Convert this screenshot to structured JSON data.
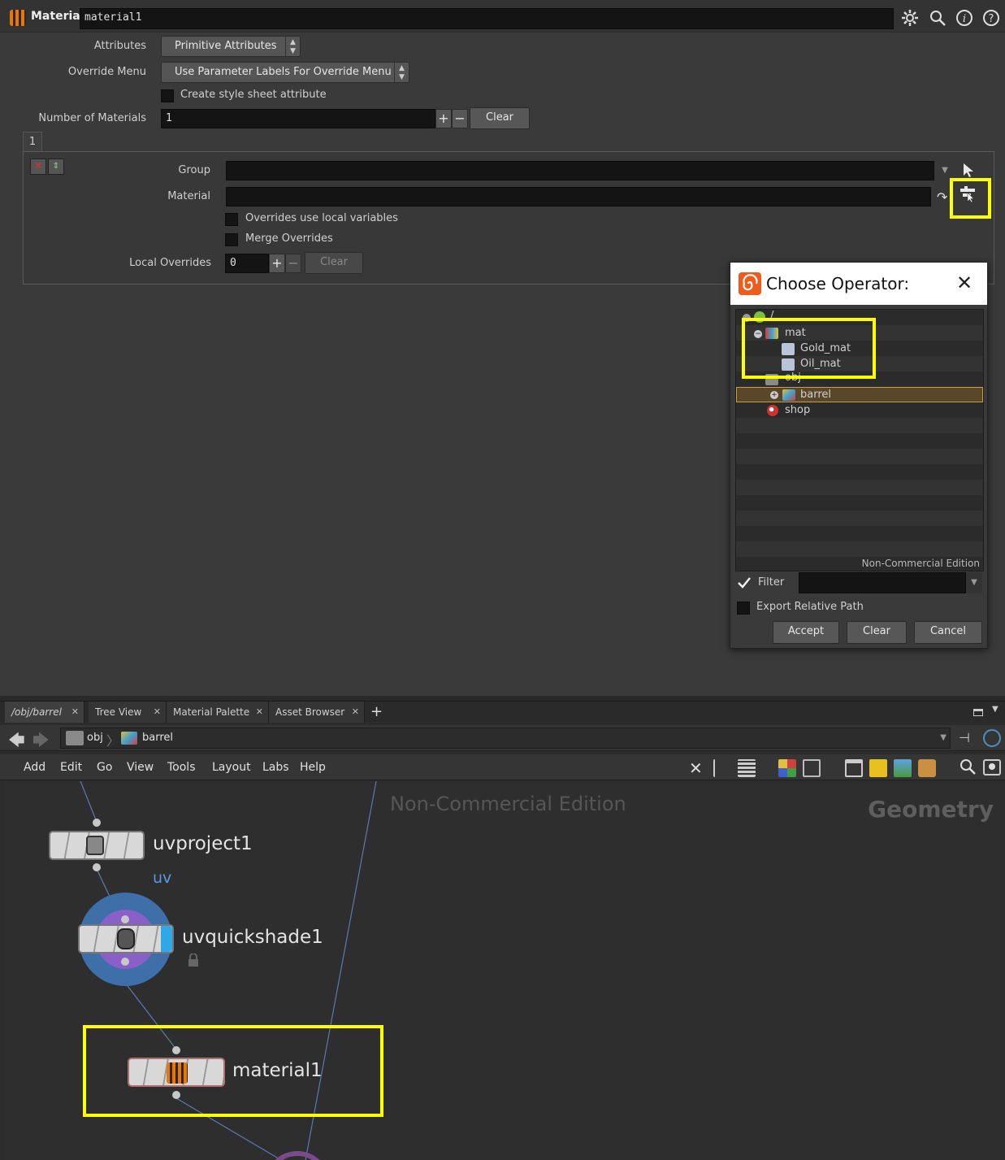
{
  "header": {
    "node_type": "Material",
    "node_name": "material1"
  },
  "params": {
    "attributes_label": "Attributes",
    "attributes_value": "Primitive Attributes",
    "override_menu_label": "Override Menu",
    "override_menu_value": "Use Parameter Labels For Override Menu",
    "create_style_label": "Create style sheet attribute",
    "num_materials_label": "Number of Materials",
    "num_materials_value": "1",
    "plus": "+",
    "minus": "−",
    "clear_label": "Clear",
    "tab_label": "1",
    "group_label": "Group",
    "group_value": "",
    "material_label": "Material",
    "material_value": "",
    "overrides_local_label": "Overrides use local variables",
    "merge_overrides_label": "Merge Overrides",
    "local_overrides_label": "Local Overrides",
    "local_overrides_value": "0",
    "local_clear_label": "Clear"
  },
  "dialog": {
    "title": "Choose Operator:",
    "tree": [
      {
        "label": "/",
        "depth": 0
      },
      {
        "label": "mat",
        "depth": 1
      },
      {
        "label": "Gold_mat",
        "depth": 2
      },
      {
        "label": "Oil_mat",
        "depth": 2
      },
      {
        "label": "obj",
        "depth": 1
      },
      {
        "label": "barrel",
        "depth": 2
      },
      {
        "label": "shop",
        "depth": 1
      }
    ],
    "watermark": "Non-Commercial Edition",
    "filter_label": "Filter",
    "filter_value": "",
    "export_relative_label": "Export Relative Path",
    "accept_label": "Accept",
    "clear_label": "Clear",
    "cancel_label": "Cancel"
  },
  "tabs": [
    {
      "label": "/obj/barrel"
    },
    {
      "label": "Tree View"
    },
    {
      "label": "Material Palette"
    },
    {
      "label": "Asset Browser"
    }
  ],
  "tab_add": "+",
  "path": {
    "root": "obj",
    "current": "barrel"
  },
  "menu": [
    "Add",
    "Edit",
    "Go",
    "View",
    "Tools",
    "Layout",
    "Labs",
    "Help"
  ],
  "network": {
    "watermark": "Non-Commercial Edition",
    "context": "Geometry",
    "nodes": [
      {
        "name": "uvproject1"
      },
      {
        "name": "uvquickshade1"
      },
      {
        "name": "material1"
      }
    ],
    "group_tag": "uv"
  },
  "colors": {
    "highlight": "#ffff00",
    "accent_blue": "#2fa8e8",
    "node_ring_outer": "#3f6fa8",
    "node_ring_inner": "#8a5fc8",
    "houdini_orange": "#f05a1a"
  }
}
